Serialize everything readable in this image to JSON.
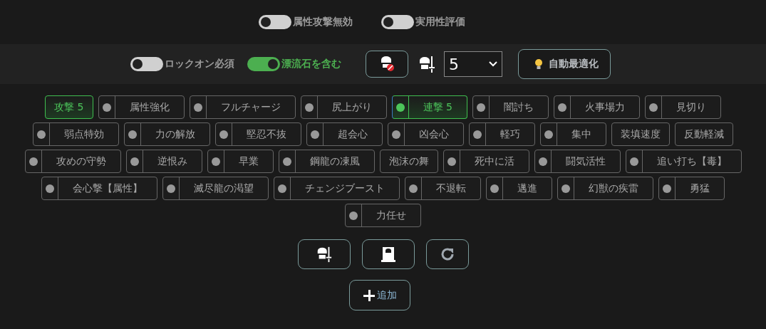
{
  "top_toggles": [
    {
      "label": "属性攻撃無効",
      "on": false
    },
    {
      "label": "実用性評価",
      "on": false
    }
  ],
  "bar": {
    "toggles": [
      {
        "label": "ロックオン必須",
        "on": false
      },
      {
        "label": "漂流石を含む",
        "on": true
      }
    ],
    "select_value": "5",
    "optimize_label": "自動最適化"
  },
  "skill_rows": [
    [
      {
        "label": "攻撃 5",
        "kind": "plain",
        "selected": true
      },
      {
        "label": "属性強化",
        "kind": "dot",
        "selected": false
      },
      {
        "label": "フルチャージ",
        "kind": "dot",
        "selected": false
      },
      {
        "label": "尻上がり",
        "kind": "dot",
        "selected": false
      },
      {
        "label": "連撃 5",
        "kind": "dot",
        "selected": true
      },
      {
        "label": "闇討ち",
        "kind": "dot",
        "selected": false
      },
      {
        "label": "火事場力",
        "kind": "dot",
        "selected": false
      },
      {
        "label": "見切り",
        "kind": "dot",
        "selected": false
      }
    ],
    [
      {
        "label": "弱点特効",
        "kind": "dot",
        "selected": false
      },
      {
        "label": "力の解放",
        "kind": "dot",
        "selected": false
      },
      {
        "label": "堅忍不抜",
        "kind": "dot",
        "selected": false
      },
      {
        "label": "超会心",
        "kind": "dot",
        "selected": false
      },
      {
        "label": "凶会心",
        "kind": "dot",
        "selected": false
      },
      {
        "label": "軽巧",
        "kind": "dot",
        "selected": false
      },
      {
        "label": "集中",
        "kind": "dot",
        "selected": false
      },
      {
        "label": "装填速度",
        "kind": "plain",
        "selected": false
      },
      {
        "label": "反動軽減",
        "kind": "plain",
        "selected": false
      }
    ],
    [
      {
        "label": "攻めの守勢",
        "kind": "dot",
        "selected": false
      },
      {
        "label": "逆恨み",
        "kind": "dot",
        "selected": false
      },
      {
        "label": "早業",
        "kind": "dot",
        "selected": false
      },
      {
        "label": "鋼龍の凍風",
        "kind": "dot",
        "selected": false
      },
      {
        "label": "泡沫の舞",
        "kind": "plain",
        "selected": false
      },
      {
        "label": "死中に活",
        "kind": "dot",
        "selected": false
      },
      {
        "label": "闘気活性",
        "kind": "dot",
        "selected": false
      },
      {
        "label": "追い打ち【毒】",
        "kind": "dot",
        "selected": false
      }
    ],
    [
      {
        "label": "会心撃【属性】",
        "kind": "dot",
        "selected": false
      },
      {
        "label": "滅尽龍の渇望",
        "kind": "dot",
        "selected": false
      },
      {
        "label": "チェンジブースト",
        "kind": "dot",
        "selected": false
      },
      {
        "label": "不退転",
        "kind": "dot",
        "selected": false
      },
      {
        "label": "邁進",
        "kind": "dot",
        "selected": false
      },
      {
        "label": "幻獣の疾雷",
        "kind": "dot",
        "selected": false
      },
      {
        "label": "勇猛",
        "kind": "dot",
        "selected": false
      }
    ],
    [
      {
        "label": "力任せ",
        "kind": "dot",
        "selected": false
      }
    ]
  ],
  "add_label": "追加"
}
